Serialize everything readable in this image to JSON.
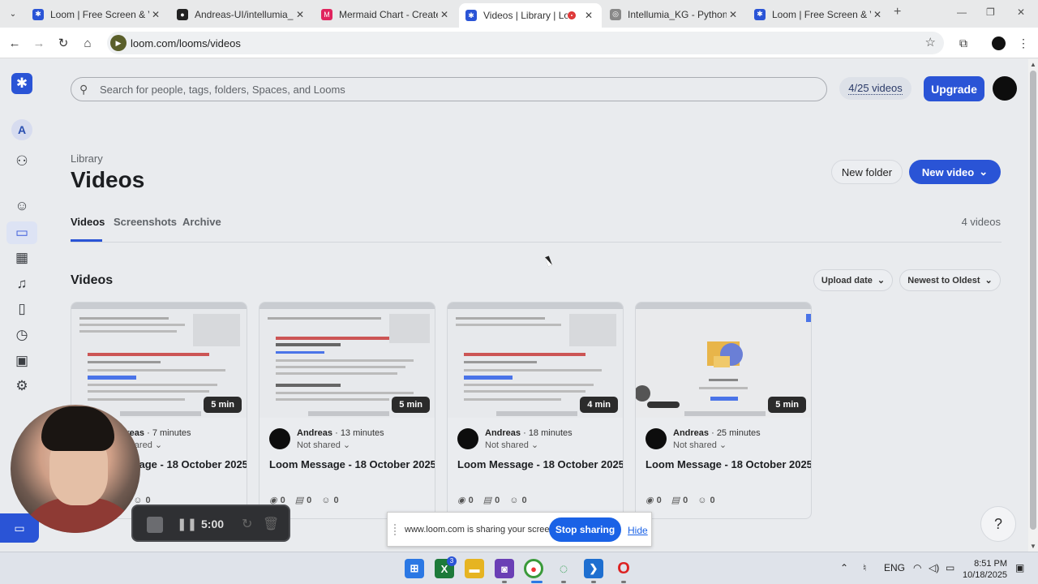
{
  "browser": {
    "tabs": [
      {
        "title": "Loom | Free Screen & Vide",
        "icon": "loom-favicon",
        "active": false
      },
      {
        "title": "Andreas-UI/intellumia_kg",
        "icon": "github-favicon",
        "active": false
      },
      {
        "title": "Mermaid Chart - Create co",
        "icon": "mermaid-favicon",
        "active": false
      },
      {
        "title": "Videos | Library | Loom",
        "icon": "loom-favicon",
        "active": true,
        "recording": true
      },
      {
        "title": "Intellumia_KG - Python KG",
        "icon": "globe-favicon",
        "active": false
      },
      {
        "title": "Loom | Free Screen & Vide",
        "icon": "loom-favicon",
        "active": false
      }
    ],
    "url": "loom.com/looms/videos"
  },
  "search": {
    "placeholder": "Search for people, tags, folders, Spaces, and Looms"
  },
  "header": {
    "usage": "4/25 videos",
    "upgrade": "Upgrade"
  },
  "sidebar": {
    "workspace_initial": "A"
  },
  "library": {
    "breadcrumb": "Library",
    "title": "Videos",
    "new_folder": "New folder",
    "new_video": "New video",
    "tabs": [
      "Videos",
      "Screenshots",
      "Archive"
    ],
    "count": "4 videos",
    "section": "Videos",
    "sort_field": "Upload date",
    "sort_order": "Newest to Oldest"
  },
  "videos": [
    {
      "duration": "5 min",
      "author": "Andreas",
      "time": "7 minutes",
      "sharing": "Not shared",
      "title": "Loom Message - 18 October 2025",
      "views": "0",
      "comments": "0",
      "reactions": "0"
    },
    {
      "duration": "5 min",
      "author": "Andreas",
      "time": "13 minutes",
      "sharing": "Not shared",
      "title": "Loom Message - 18 October 2025",
      "views": "0",
      "comments": "0",
      "reactions": "0"
    },
    {
      "duration": "4 min",
      "author": "Andreas",
      "time": "18 minutes",
      "sharing": "Not shared",
      "title": "Loom Message - 18 October 2025",
      "views": "0",
      "comments": "0",
      "reactions": "0"
    },
    {
      "duration": "5 min",
      "author": "Andreas",
      "time": "25 minutes",
      "sharing": "Not shared",
      "title": "Loom Message - 18 October 2025",
      "views": "0",
      "comments": "0",
      "reactions": "0"
    }
  ],
  "recorder": {
    "time": "5:00"
  },
  "share_bar": {
    "message": "www.loom.com is sharing your screen.",
    "stop": "Stop sharing",
    "hide": "Hide"
  },
  "taskbar": {
    "language": "ENG",
    "time": "8:51 PM",
    "date": "10/18/2025",
    "badge": "3"
  },
  "help": "?",
  "colors": {
    "accent": "#2a54d6",
    "background": "#e9ebee"
  }
}
